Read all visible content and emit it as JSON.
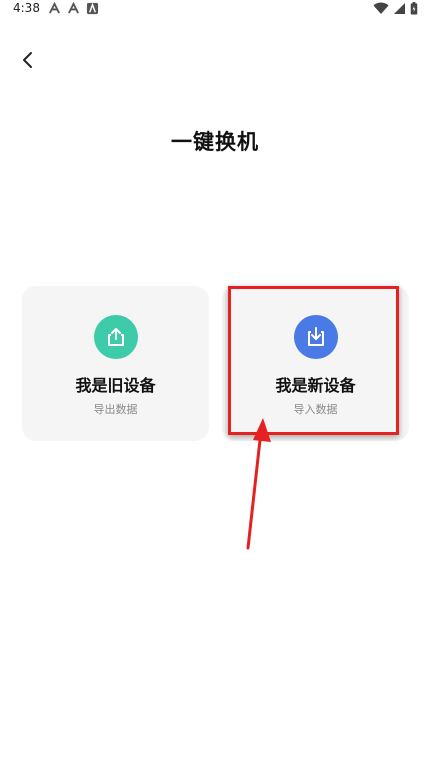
{
  "status_bar": {
    "time": "4:38",
    "notification_icons": [
      "app-notification-icon",
      "app-notification-icon",
      "app-notification-icon"
    ],
    "right_icons": [
      "wifi-icon",
      "signal-icon",
      "battery-icon"
    ]
  },
  "header": {
    "back_icon": "chevron-left-icon",
    "title": "一键换机"
  },
  "cards": {
    "old_device": {
      "title": "我是旧设备",
      "subtitle": "导出数据",
      "icon": "export-icon",
      "icon_color": "#3ecba9"
    },
    "new_device": {
      "title": "我是新设备",
      "subtitle": "导入数据",
      "icon": "import-icon",
      "icon_color": "#4a7ae5"
    }
  },
  "annotation": {
    "color": "#e52121",
    "shapes": [
      "highlight-box",
      "pointer-arrow"
    ]
  }
}
